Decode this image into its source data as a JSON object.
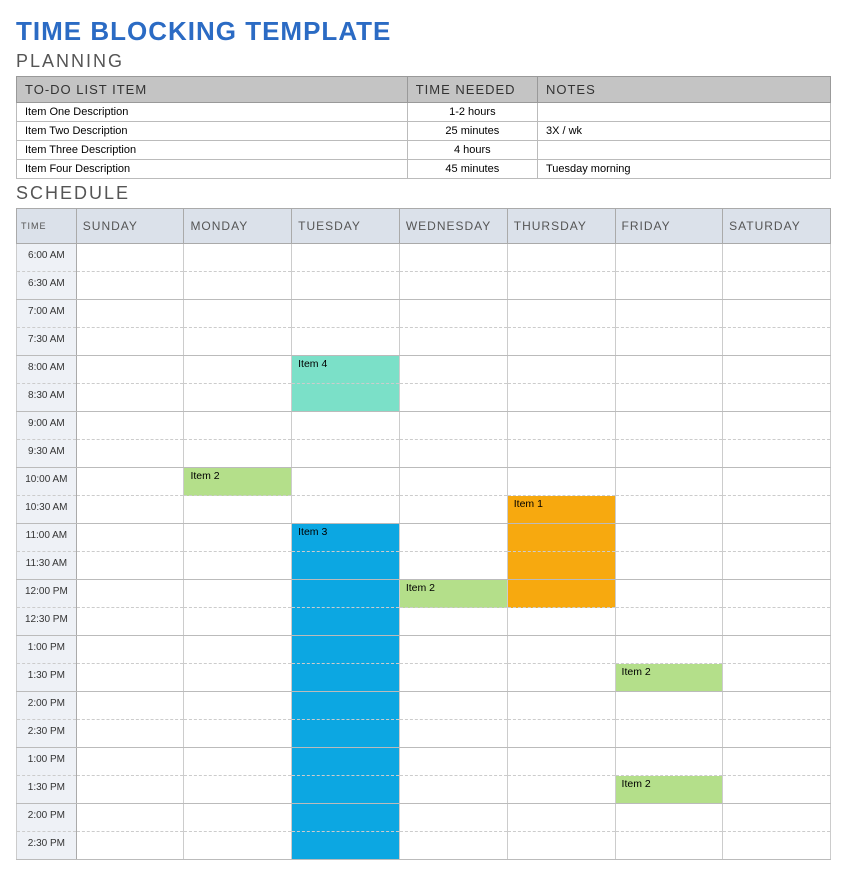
{
  "title": "TIME BLOCKING TEMPLATE",
  "sections": {
    "planning": "PLANNING",
    "schedule": "SCHEDULE"
  },
  "planning": {
    "headers": {
      "item": "TO-DO LIST ITEM",
      "time": "TIME NEEDED",
      "notes": "NOTES"
    },
    "rows": [
      {
        "item": "Item One Description",
        "time": "1-2 hours",
        "notes": ""
      },
      {
        "item": "Item Two Description",
        "time": "25 minutes",
        "notes": "3X / wk"
      },
      {
        "item": "Item Three Description",
        "time": "4 hours",
        "notes": ""
      },
      {
        "item": "Item Four Description",
        "time": "45 minutes",
        "notes": "Tuesday morning"
      }
    ]
  },
  "schedule": {
    "timeHeader": "TIME",
    "days": [
      "SUNDAY",
      "MONDAY",
      "TUESDAY",
      "WEDNESDAY",
      "THURSDAY",
      "FRIDAY",
      "SATURDAY"
    ],
    "times": [
      "6:00 AM",
      "6:30 AM",
      "7:00 AM",
      "7:30 AM",
      "8:00 AM",
      "8:30 AM",
      "9:00 AM",
      "9:30 AM",
      "10:00 AM",
      "10:30 AM",
      "11:00 AM",
      "11:30 AM",
      "12:00 PM",
      "12:30 PM",
      "1:00 PM",
      "1:30 PM",
      "2:00 PM",
      "2:30 PM",
      "1:00 PM",
      "1:30 PM",
      "2:00 PM",
      "2:30 PM"
    ],
    "blocks": {
      "item1": "Item 1",
      "item2": "Item 2",
      "item3": "Item 3",
      "item4": "Item 4"
    }
  }
}
